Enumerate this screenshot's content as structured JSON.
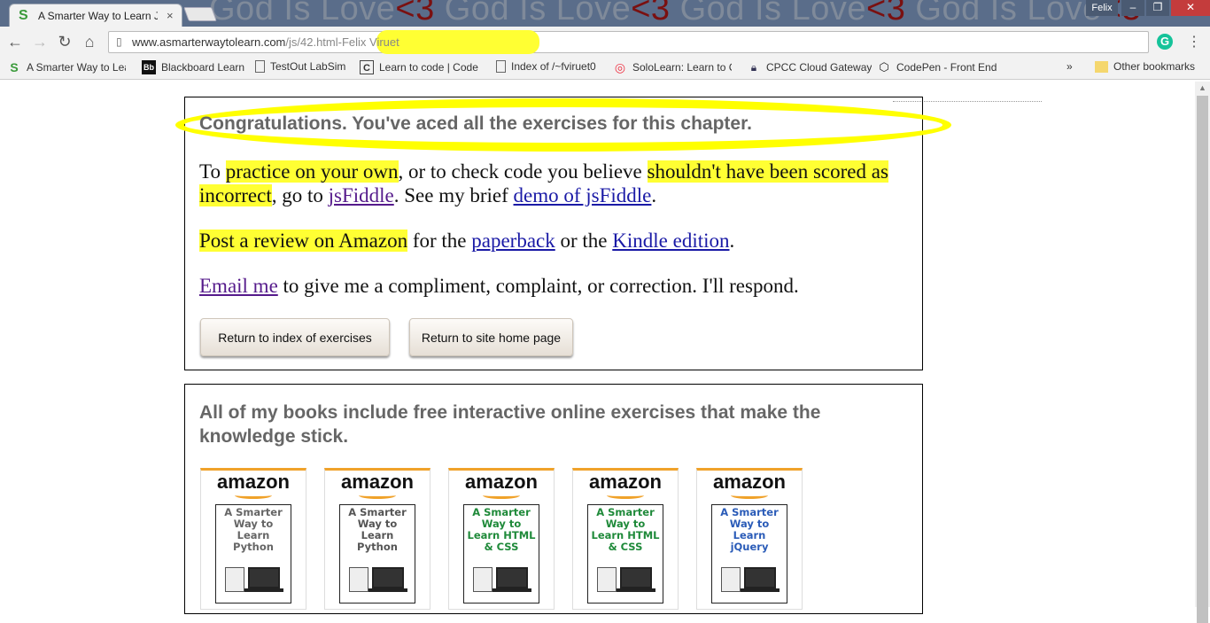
{
  "browser": {
    "banner_text": "God Is Love",
    "banner_heart": "<3",
    "tab_title": "A Smarter Way to Learn J",
    "tab_close": "×",
    "profile_name": "Felix",
    "url_host": "www.asmarterwaytolearn.com",
    "url_path": "/js/42.html-Felix Viruet",
    "extension_icon": "G",
    "bookmarks": [
      {
        "label": "A Smarter Way to Lea",
        "icon": "S"
      },
      {
        "label": "Blackboard Learn",
        "icon": "Bb"
      },
      {
        "label": "TestOut LabSim",
        "icon": "page-icon"
      },
      {
        "label": "Learn to code | Code",
        "icon": "C"
      },
      {
        "label": "Index of /~fviruet0",
        "icon": "page-icon"
      },
      {
        "label": "SoloLearn: Learn to C",
        "icon": "solo-icon"
      },
      {
        "label": "CPCC Cloud Gateway",
        "icon": "lock-icon"
      },
      {
        "label": "CodePen - Front End",
        "icon": "codepen-icon"
      }
    ],
    "bookmarks_overflow": "»",
    "other_bookmarks": "Other bookmarks"
  },
  "content": {
    "congrats": "Congratulations. You've aced all the exercises for this chapter.",
    "p1": {
      "t1": "To ",
      "h1": "practice on your own",
      "t2": ", or to check code you believe ",
      "h2": "shouldn't have been scored as incorrect",
      "t3": ", go to ",
      "l1": "jsFiddle",
      "t4": ". See my brief ",
      "l2": "demo of jsFiddle",
      "t5": "."
    },
    "p2": {
      "h1": "Post a review on Amazon",
      "t1": " for the ",
      "l1": "paperback",
      "t2": " or the ",
      "l2": "Kindle edition",
      "t3": "."
    },
    "p3": {
      "l1": "Email me",
      "t1": " to give me a compliment, complaint, or correction. I'll respond."
    },
    "btn_index": "Return to index of exercises",
    "btn_home": "Return to site home page",
    "books_heading": " All of my books include free interactive online exercises that make the knowledge stick.",
    "books": [
      {
        "store": "amazon",
        "title": "A Smarter Way to Learn Python",
        "color": "#666666"
      },
      {
        "store": "amazon",
        "title": "A Smarter Way to Learn Python",
        "color": "#555555"
      },
      {
        "store": "amazon",
        "title": "A Smarter Way to Learn HTML & CSS",
        "color": "#1f8a3a"
      },
      {
        "store": "amazon",
        "title": "A Smarter Way to Learn HTML & CSS",
        "color": "#1f8a3a"
      },
      {
        "store": "amazon",
        "title": "A Smarter Way to Learn jQuery",
        "color": "#2b5cb8"
      }
    ]
  }
}
